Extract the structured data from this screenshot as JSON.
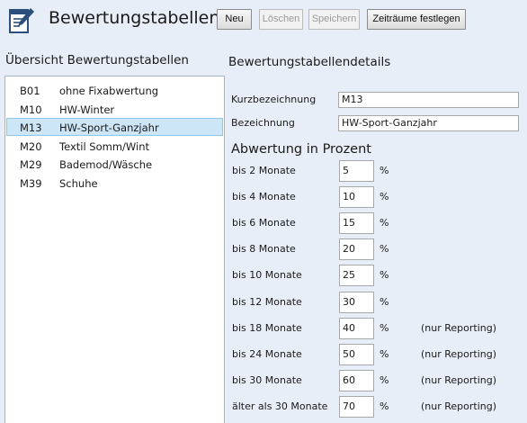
{
  "app": {
    "title": "Bewertungstabellen",
    "toolbar": {
      "new_label": "Neu",
      "delete_label": "Löschen",
      "save_label": "Speichern",
      "periods_label": "Zeiträume festlegen"
    }
  },
  "list": {
    "title": "Übersicht Bewertungstabellen",
    "selected_index": 2,
    "items": [
      {
        "code": "B01",
        "name": "ohne Fixabwertung"
      },
      {
        "code": "M10",
        "name": "HW-Winter"
      },
      {
        "code": "M13",
        "name": "HW-Sport-Ganzjahr"
      },
      {
        "code": "M20",
        "name": "Textil Somm/Wint"
      },
      {
        "code": "M29",
        "name": "Bademod/Wäsche"
      },
      {
        "code": "M39",
        "name": "Schuhe"
      }
    ]
  },
  "details": {
    "title": "Bewertungstabellendetails",
    "short_label": "Kurzbezeichnung",
    "short_value": "M13",
    "name_label": "Bezeichnung",
    "name_value": "HW-Sport-Ganzjahr",
    "section_title": "Abwertung in Prozent",
    "unit": "%",
    "periods": [
      {
        "label": "bis 2 Monate",
        "value": "5",
        "note": ""
      },
      {
        "label": "bis 4 Monate",
        "value": "10",
        "note": ""
      },
      {
        "label": "bis 6 Monate",
        "value": "15",
        "note": ""
      },
      {
        "label": "bis 8 Monate",
        "value": "20",
        "note": ""
      },
      {
        "label": "bis 10 Monate",
        "value": "25",
        "note": ""
      },
      {
        "label": "bis 12 Monate",
        "value": "30",
        "note": ""
      },
      {
        "label": "bis 18 Monate",
        "value": "40",
        "note": "(nur Reporting)"
      },
      {
        "label": "bis 24 Monate",
        "value": "50",
        "note": "(nur Reporting)"
      },
      {
        "label": "bis 30 Monate",
        "value": "60",
        "note": "(nur Reporting)"
      },
      {
        "label": "älter als 30 Monate",
        "value": "70",
        "note": "(nur Reporting)"
      }
    ]
  }
}
